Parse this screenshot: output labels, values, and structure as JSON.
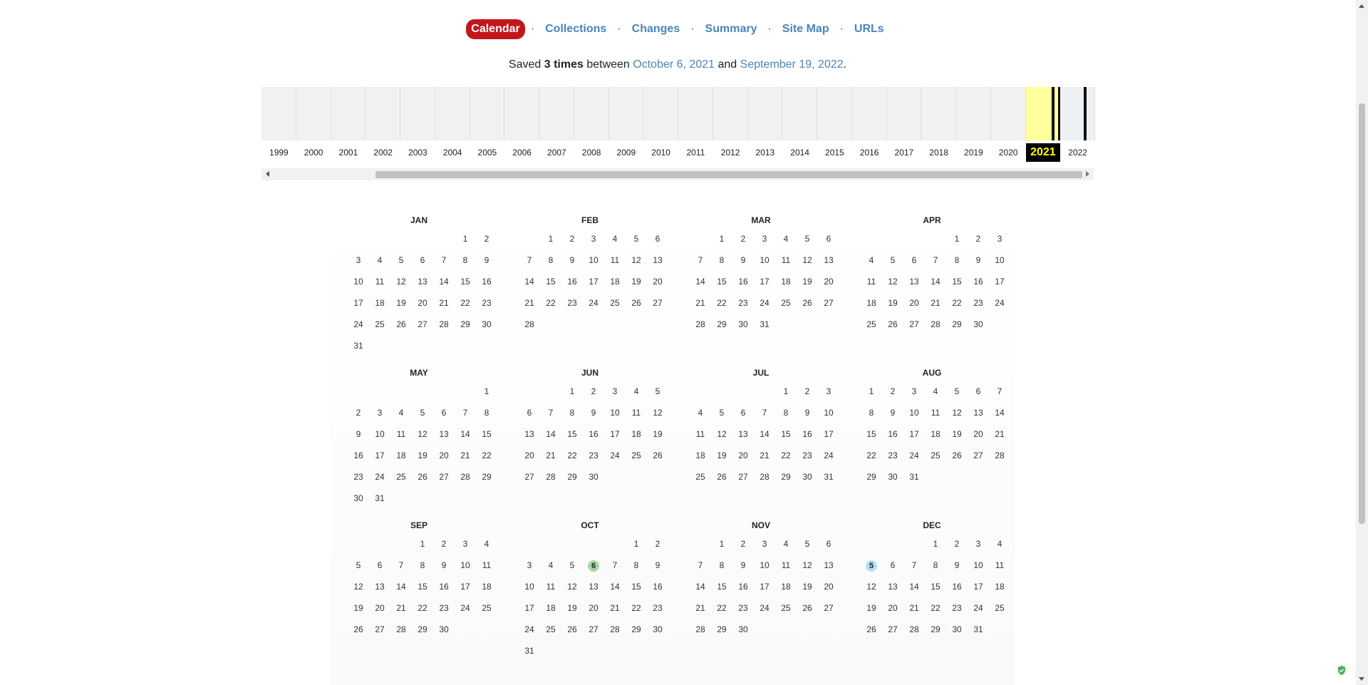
{
  "nav": {
    "items": [
      {
        "label": "Calendar",
        "active": true
      },
      {
        "label": "Collections",
        "active": false
      },
      {
        "label": "Changes",
        "active": false
      },
      {
        "label": "Summary",
        "active": false
      },
      {
        "label": "Site Map",
        "active": false
      },
      {
        "label": "URLs",
        "active": false
      }
    ],
    "separator": "·"
  },
  "summary": {
    "prefix": "Saved",
    "count": "3 times",
    "between": "between",
    "first_date": "October 6, 2021",
    "and": "and",
    "last_date": "September 19, 2022",
    "period": "."
  },
  "timeline": {
    "years": [
      "1999",
      "2000",
      "2001",
      "2002",
      "2003",
      "2004",
      "2005",
      "2006",
      "2007",
      "2008",
      "2009",
      "2010",
      "2011",
      "2012",
      "2013",
      "2014",
      "2015",
      "2016",
      "2017",
      "2018",
      "2019",
      "2020",
      "2021",
      "2022"
    ],
    "selected_year": "2021",
    "highlight_color": "#ffff9c"
  },
  "calendar": {
    "months": [
      {
        "name": "JAN",
        "offset": 5,
        "days": 31
      },
      {
        "name": "FEB",
        "offset": 1,
        "days": 28
      },
      {
        "name": "MAR",
        "offset": 1,
        "days": 31
      },
      {
        "name": "APR",
        "offset": 4,
        "days": 30
      },
      {
        "name": "MAY",
        "offset": 6,
        "days": 31
      },
      {
        "name": "JUN",
        "offset": 2,
        "days": 30
      },
      {
        "name": "JUL",
        "offset": 4,
        "days": 31
      },
      {
        "name": "AUG",
        "offset": 0,
        "days": 31
      },
      {
        "name": "SEP",
        "offset": 3,
        "days": 30
      },
      {
        "name": "OCT",
        "offset": 5,
        "days": 31
      },
      {
        "name": "NOV",
        "offset": 1,
        "days": 30
      },
      {
        "name": "DEC",
        "offset": 3,
        "days": 31
      }
    ],
    "snapshots": [
      {
        "month": "OCT",
        "day": 6,
        "color": "green"
      },
      {
        "month": "DEC",
        "day": 5,
        "color": "blue"
      }
    ]
  },
  "colors": {
    "accent": "#c2161d",
    "link": "#4a85b9",
    "snapshot_green": "#a5d6a7",
    "snapshot_blue": "#b3e0f2"
  },
  "icons": {
    "shield": "shield-check-icon"
  }
}
